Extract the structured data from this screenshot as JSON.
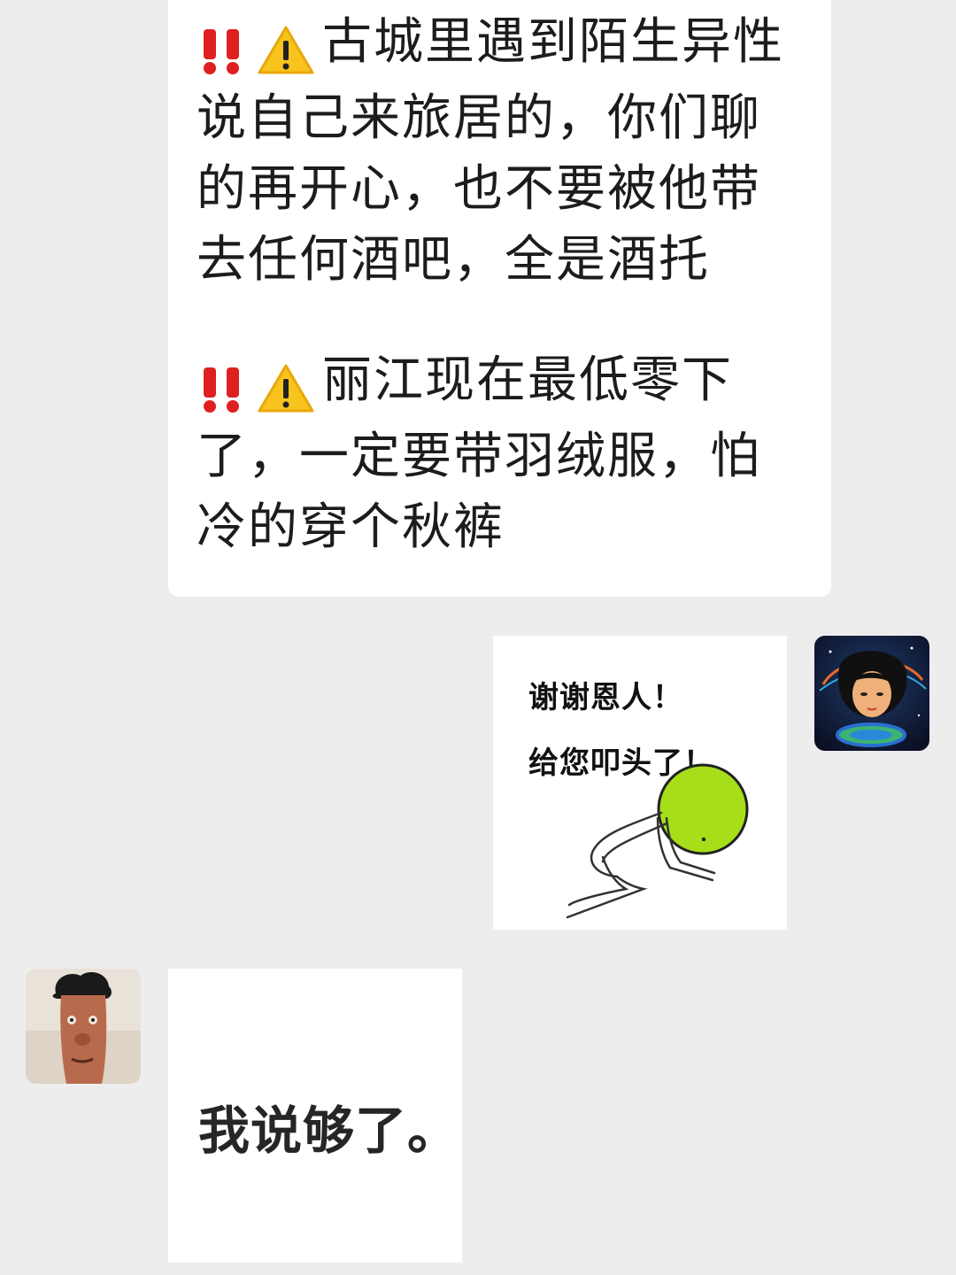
{
  "messages": {
    "incoming_text": {
      "paragraph1": "古城里遇到陌生异性说自己来旅居的，你们聊的再开心，也不要被他带去任何酒吧，全是酒托",
      "paragraph2": "丽江现在最低零下了，一定要带羽绒服，怕冷的穿个秋裤",
      "prefix_icons": [
        "double-exclamation-icon",
        "warning-icon"
      ]
    },
    "outgoing_sticker": {
      "line1": "谢谢恩人！",
      "line2": "给您叩头了！",
      "figure": "kowtowing-stick-figure-green-head"
    },
    "incoming_sticker": {
      "text": "我说够了。"
    }
  },
  "avatars": {
    "self": "galaxy-girl-avatar",
    "other": "cartoon-face-avatar"
  },
  "colors": {
    "background": "#ededed",
    "bubble": "#ffffff",
    "emoji_red": "#e02020",
    "warning_yellow": "#f8c31c",
    "sticker_green": "#a6df1a"
  }
}
